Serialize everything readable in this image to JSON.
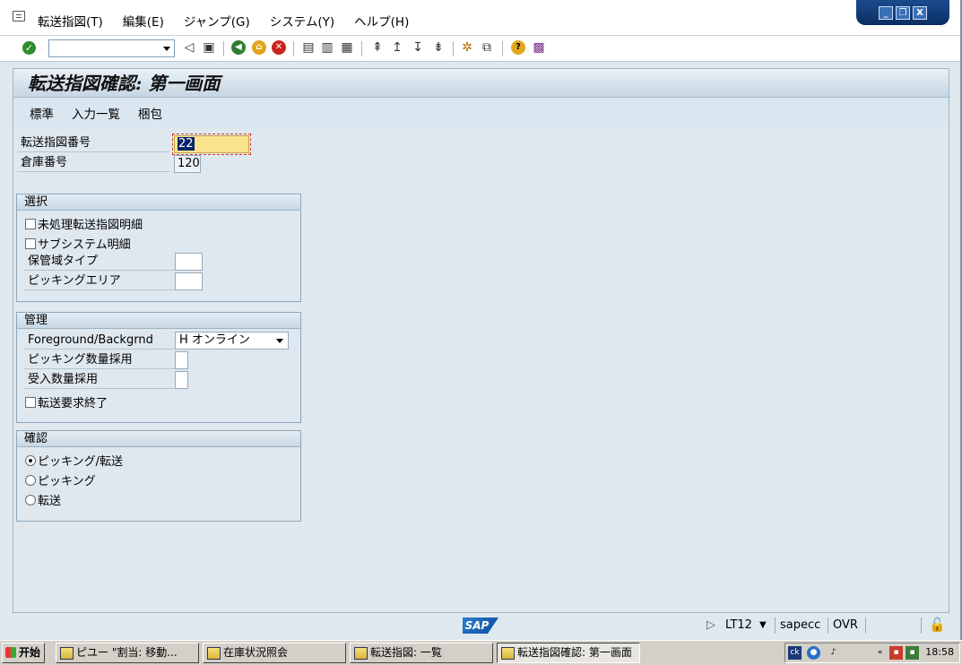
{
  "menubar": {
    "items": [
      "転送指図(T)",
      "編集(E)",
      "ジャンプ(G)",
      "システム(Y)",
      "ヘルプ(H)"
    ]
  },
  "window_controls": {
    "minimize": "_",
    "restore": "❐",
    "close": "X"
  },
  "title": "転送指図確認: 第一画面",
  "app_toolbar": [
    "標準",
    "入力一覧",
    "梱包"
  ],
  "header_fields": {
    "transfer_order_number": {
      "label": "転送指図番号",
      "value": "22"
    },
    "warehouse_number": {
      "label": "倉庫番号",
      "value": "120"
    }
  },
  "selection": {
    "title": "選択",
    "open_items": {
      "label": "未処理転送指図明細",
      "checked": false
    },
    "subsystem_items": {
      "label": "サブシステム明細",
      "checked": false
    },
    "storage_type": {
      "label": "保管域タイプ",
      "value": ""
    },
    "picking_area": {
      "label": "ピッキングエリア",
      "value": ""
    }
  },
  "control": {
    "title": "管理",
    "foreground": {
      "label": "Foreground/Backgrnd",
      "value": "H オンライン"
    },
    "adopt_pick_qty": {
      "label": "ピッキング数量採用",
      "value": ""
    },
    "adopt_recv_qty": {
      "label": "受入数量採用",
      "value": ""
    },
    "transfer_req_complete": {
      "label": "転送要求終了",
      "checked": false
    }
  },
  "confirmation": {
    "title": "確認",
    "options": [
      {
        "label": "ピッキング/転送",
        "selected": true
      },
      {
        "label": "ピッキング",
        "selected": false
      },
      {
        "label": "転送",
        "selected": false
      }
    ]
  },
  "statusbar": {
    "logo": "SAP",
    "transaction": "LT12",
    "server": "sapecc",
    "mode": "OVR"
  },
  "taskbar": {
    "start": "开始",
    "tasks": [
      "ピユー \"割当: 移動...",
      "在庫状況照会",
      "転送指図: 一覧",
      "転送指図確認: 第一画面"
    ],
    "tray_time": "18:58"
  },
  "colors": {
    "input_highlight": "#fbe48e",
    "group_header": "#c8d8e5",
    "background": "#dfe8ef"
  }
}
